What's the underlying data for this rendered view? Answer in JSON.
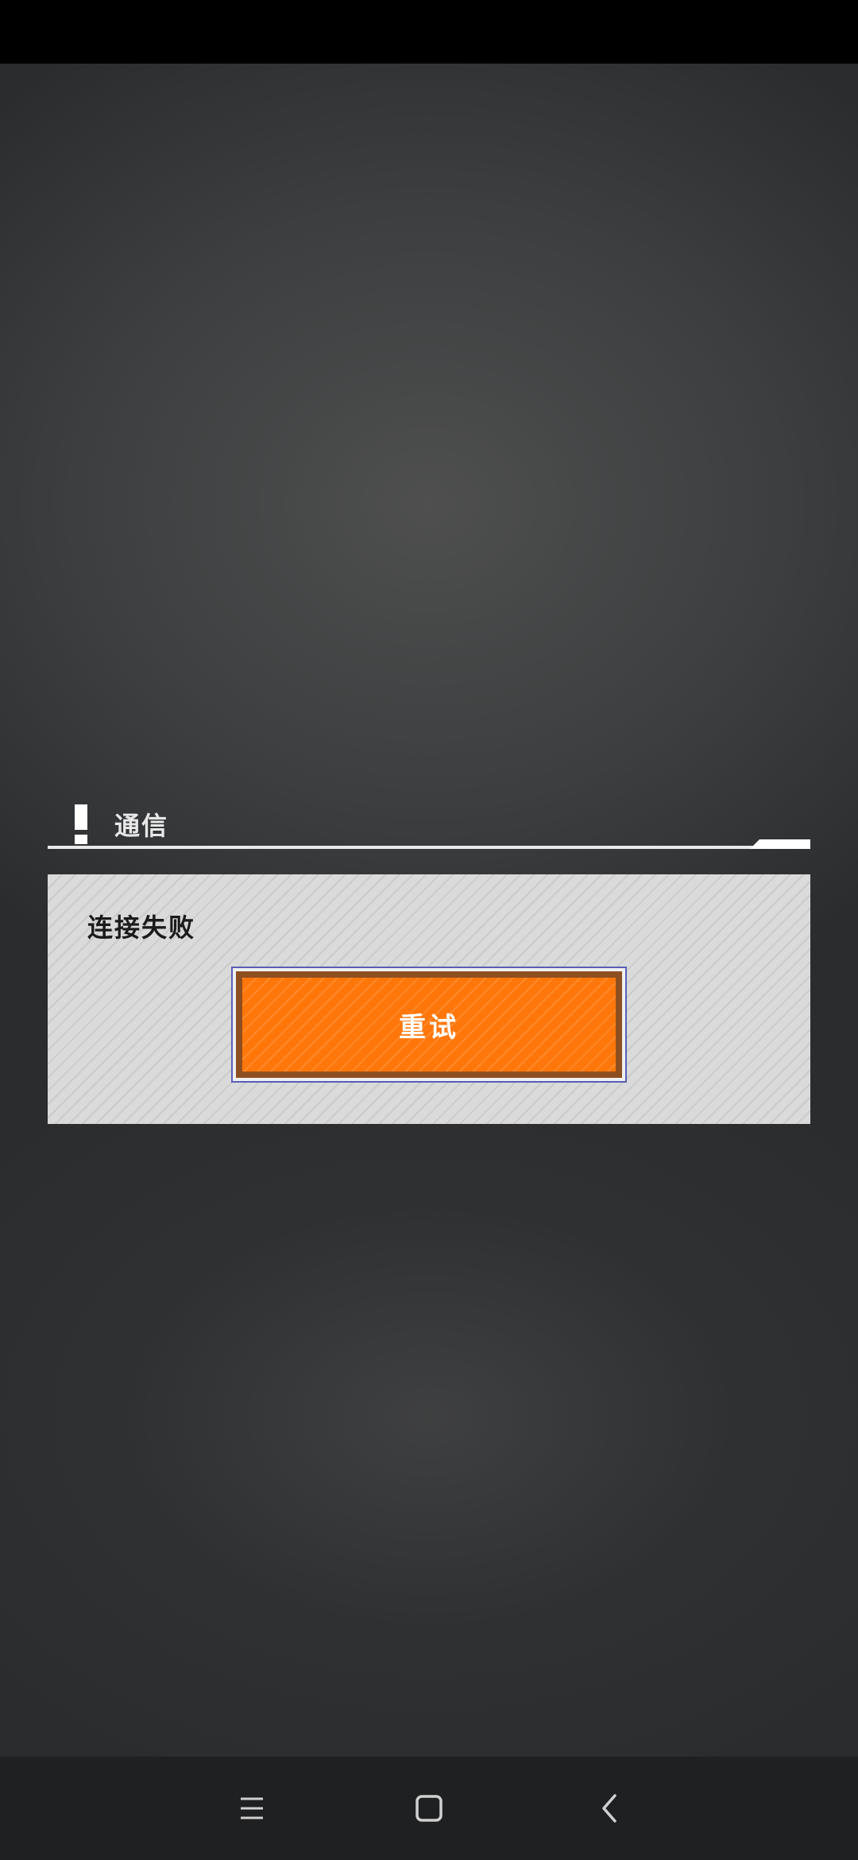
{
  "dialog": {
    "title": "通信",
    "message": "连接失败",
    "retry_label": "重试"
  },
  "nav": {
    "menu_icon": "menu-lines-icon",
    "home_icon": "square-home-icon",
    "back_icon": "chevron-left-icon"
  },
  "colors": {
    "button_orange": "#ff7a10",
    "button_border": "#8e4f20",
    "panel_gray": "#d6d6d6",
    "nav_bar": "#1f2021"
  }
}
